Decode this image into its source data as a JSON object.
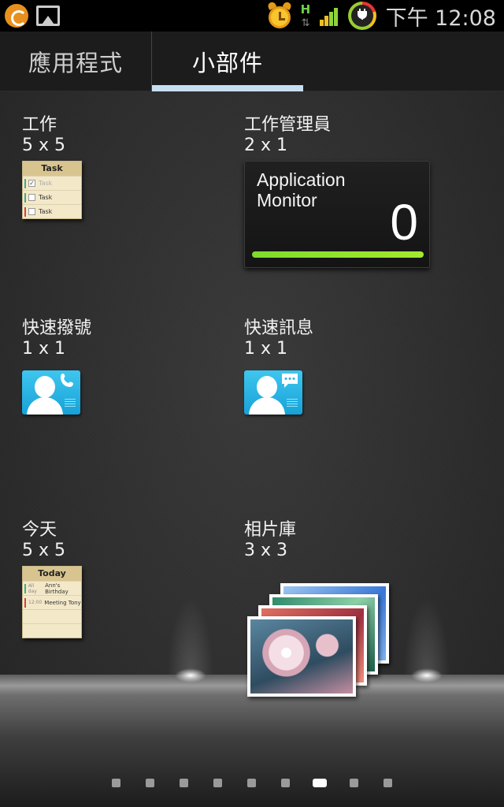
{
  "statusbar": {
    "clock": "下午 12:08",
    "icons": [
      "orange-notification-icon",
      "picture-notification-icon",
      "alarm-clock-icon",
      "hspa-data-icon",
      "signal-strength-icon",
      "battery-charging-icon"
    ],
    "data_indicator": "H",
    "data_arrows": "⇅"
  },
  "tabs": {
    "apps": "應用程式",
    "widgets": "小部件",
    "active": "widgets"
  },
  "widgets": [
    {
      "name": "工作",
      "size": "5 x 5",
      "preview": {
        "header": "Task",
        "rows": [
          "Task",
          "Task",
          "Task"
        ]
      }
    },
    {
      "name": "工作管理員",
      "size": "2 x 1",
      "preview": {
        "title": "Application Monitor",
        "value": "0"
      }
    },
    {
      "name": "快速撥號",
      "size": "1 x 1",
      "preview": {
        "icon": "contact-phone-icon"
      }
    },
    {
      "name": "快速訊息",
      "size": "1 x 1",
      "preview": {
        "icon": "contact-message-icon"
      }
    },
    {
      "name": "今天",
      "size": "5 x 5",
      "preview": {
        "header": "Today",
        "rows": [
          {
            "tag": "All day",
            "text": "Ann's Birthday"
          },
          {
            "tag": "12:00",
            "text": "Meeting Tony"
          }
        ]
      }
    },
    {
      "name": "相片庫",
      "size": "3 x 3",
      "preview": {
        "icon": "photo-stack-icon"
      }
    }
  ],
  "pager": {
    "count": 9,
    "current": 7
  },
  "colors": {
    "tab_indicator": "#c6dff0",
    "monitor_meter": "#8be22c",
    "contact_icon": "#29b6e6",
    "note_paper": "#f3e9c9"
  }
}
